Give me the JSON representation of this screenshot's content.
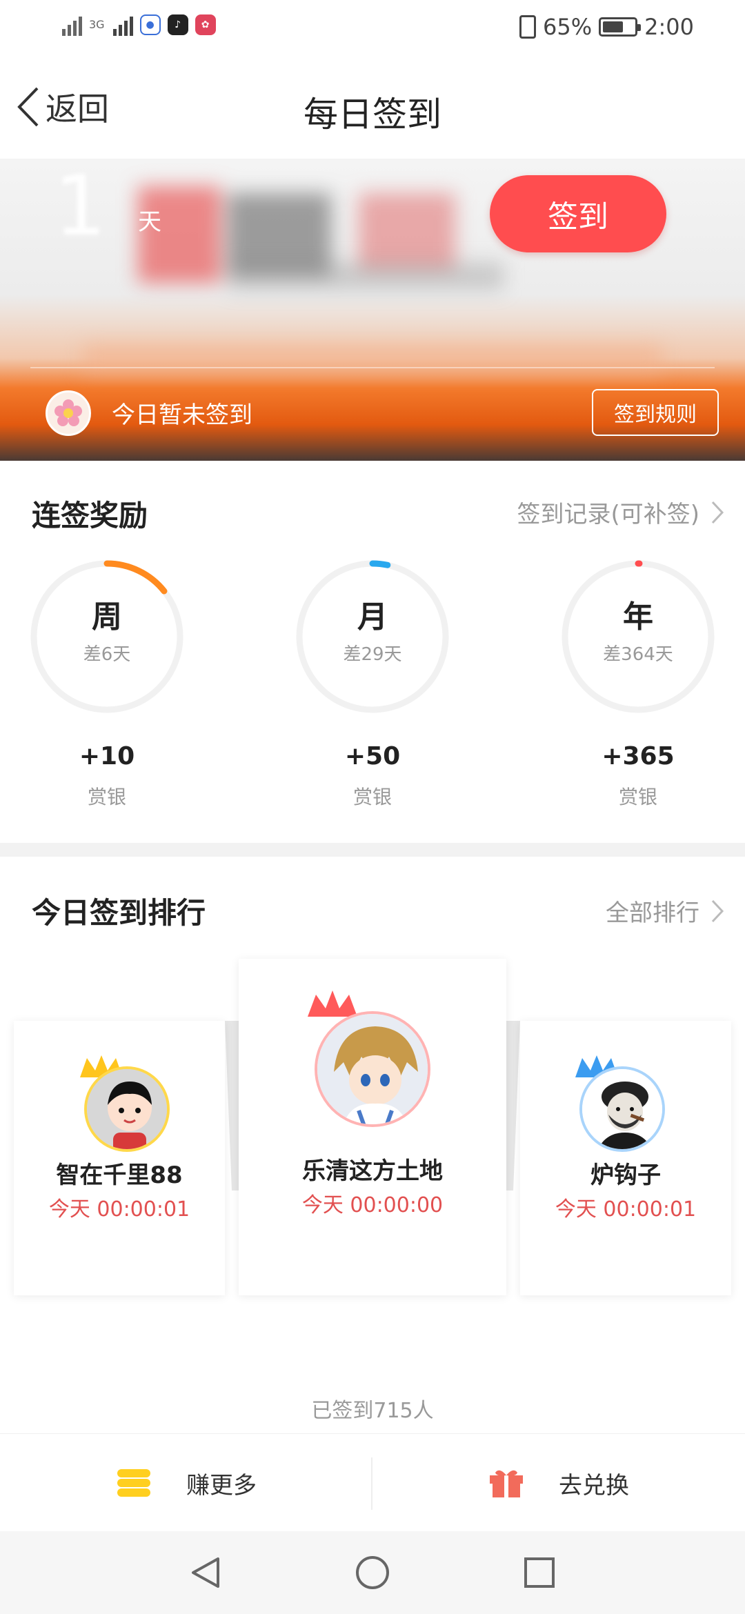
{
  "status_bar": {
    "network_label": "3G",
    "battery": "65%",
    "time": "2:00"
  },
  "nav": {
    "back_label": "返回",
    "title": "每日签到"
  },
  "banner": {
    "days": "1",
    "days_unit": "天",
    "signin_button": "签到",
    "status_text": "今日暂未签到",
    "rules_button": "签到规则"
  },
  "streak": {
    "title": "连签奖励",
    "record_link": "签到记录(可补签)",
    "items": [
      {
        "period": "周",
        "remaining": "差6天",
        "progress": 0.143,
        "color": "#ff8a1f",
        "reward": "+10",
        "currency": "赏银"
      },
      {
        "period": "月",
        "remaining": "差29天",
        "progress": 0.033,
        "color": "#29a8ee",
        "reward": "+50",
        "currency": "赏银"
      },
      {
        "period": "年",
        "remaining": "差364天",
        "progress": 0.003,
        "color": "#ff4d4f",
        "reward": "+365",
        "currency": "赏银"
      }
    ]
  },
  "ranking": {
    "title": "今日签到排行",
    "all_link": "全部排行",
    "entries": [
      {
        "rank": 2,
        "name": "智在千里88",
        "time": "今天 00:00:01",
        "crown_color": "#ffc51c"
      },
      {
        "rank": 1,
        "name": "乐清这方土地",
        "time": "今天 00:00:00",
        "crown_color": "#ff5a5a"
      },
      {
        "rank": 3,
        "name": "炉钩子",
        "time": "今天 00:00:01",
        "crown_color": "#3b9cf0"
      }
    ],
    "signed_count": "已签到715人"
  },
  "actions": {
    "earn_more": "赚更多",
    "redeem": "去兑换"
  },
  "colors": {
    "accent_red": "#ff4d4f",
    "banner_orange": "#e35a10"
  }
}
